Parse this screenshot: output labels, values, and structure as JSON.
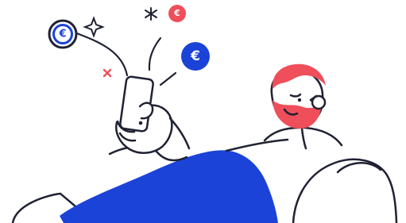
{
  "illustration": {
    "coins": [
      {
        "symbol": "€",
        "icon": "euro-coin-outline-icon",
        "color": "#2d3047"
      },
      {
        "symbol": "€",
        "icon": "euro-coin-red-icon",
        "color": "#ef4f5a"
      },
      {
        "symbol": "€",
        "icon": "euro-coin-blue-icon",
        "color": "#1b43d8"
      }
    ],
    "decorations": [
      {
        "icon": "sparkle-icon"
      },
      {
        "icon": "asterisk-icon"
      },
      {
        "icon": "cross-icon",
        "color": "#ef4f5a"
      }
    ],
    "colors": {
      "outline": "#1f2233",
      "blanket": "#1b43d8",
      "hair_beard": "#ef4f5a",
      "background": "#ffffff"
    }
  }
}
